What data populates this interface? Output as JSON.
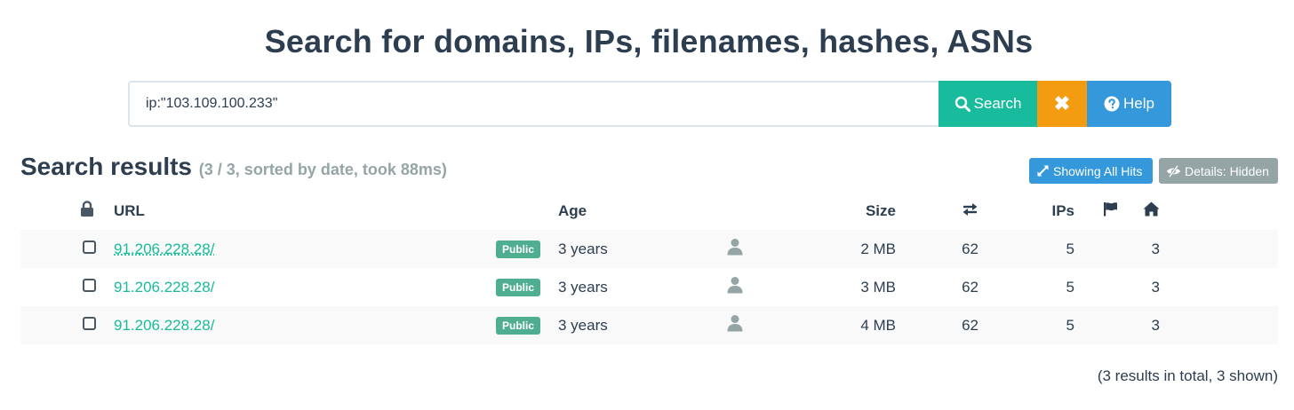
{
  "header": {
    "title": "Search for domains, IPs, filenames, hashes, ASNs"
  },
  "search": {
    "value": "ip:\"103.109.100.233\"",
    "search_label": "Search",
    "clear_label": "✖",
    "help_label": "Help"
  },
  "results": {
    "title": "Search results",
    "meta": "(3 / 3, sorted by date, took 88ms)",
    "showing_all_hits_label": "Showing All Hits",
    "details_label": "Details: Hidden",
    "columns": {
      "url": "URL",
      "age": "Age",
      "size": "Size",
      "ips": "IPs"
    },
    "rows": [
      {
        "url": "91.206.228.28/",
        "badge": "Public",
        "age": "3 years",
        "size": "2 MB",
        "subrequests": "62",
        "ips": "5",
        "countries": "3"
      },
      {
        "url": "91.206.228.28/",
        "badge": "Public",
        "age": "3 years",
        "size": "3 MB",
        "subrequests": "62",
        "ips": "5",
        "countries": "3"
      },
      {
        "url": "91.206.228.28/",
        "badge": "Public",
        "age": "3 years",
        "size": "4 MB",
        "subrequests": "62",
        "ips": "5",
        "countries": "3"
      }
    ],
    "footer": "(3 results in total, 3 shown)"
  },
  "icons": {
    "search": "magnifier-icon",
    "help": "question-circle-icon",
    "lock": "lock-icon",
    "exchange": "exchange-arrows-icon",
    "flag": "flag-icon",
    "home": "home-icon",
    "user": "user-icon",
    "expand": "expand-arrows-icon",
    "eye_slash": "eye-slash-icon"
  },
  "colors": {
    "primary_text": "#2c3e50",
    "success": "#18bc9c",
    "warning": "#f39c12",
    "info": "#3498db",
    "muted": "#95a5a6",
    "badge": "#4fae8f"
  }
}
